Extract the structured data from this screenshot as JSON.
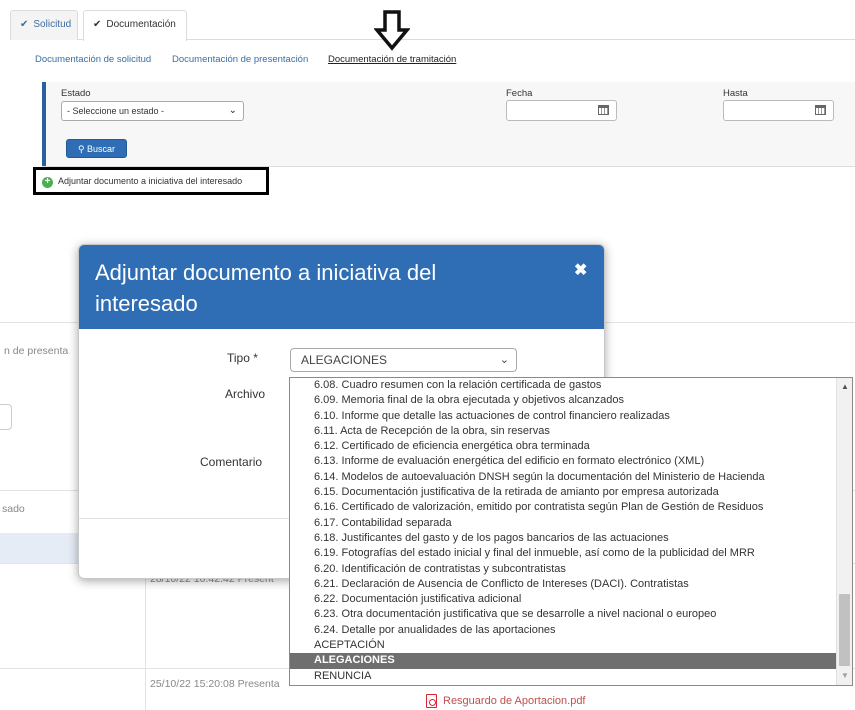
{
  "tabs": {
    "solicitud": "Solicitud",
    "documentacion": "Documentación",
    "check": "✔"
  },
  "subtabs": {
    "solicitud": "Documentación de solicitud",
    "presentacion": "Documentación de presentación",
    "tramitacion": "Documentación de tramitación"
  },
  "filter": {
    "estado_label": "Estado",
    "estado_value": "- Seleccione un estado -",
    "fecha_label": "Fecha",
    "hasta_label": "Hasta",
    "buscar": "Buscar"
  },
  "attach_link": "Adjuntar documento a iniciativa del interesado",
  "background": {
    "frag_presenta": "n de presenta",
    "frag_sado": "sado",
    "row1_date": "28/10/22 10:42:42 Present",
    "row2_date": "25/10/22 15:20:08 Presenta",
    "pdf": "Resguardo de Aportacion.pdf"
  },
  "modal": {
    "title": "Adjuntar documento a iniciativa del interesado",
    "close": "✖",
    "tipo_label": "Tipo  *",
    "tipo_value": "ALEGACIONES",
    "archivo_label": "Archivo",
    "comentario_label": "Comentario"
  },
  "dropdown": {
    "items": [
      {
        "text": "6.08. Cuadro resumen con la relación certificada de gastos",
        "kind": "indent"
      },
      {
        "text": "6.09. Memoria final de la obra ejecutada y objetivos alcanzados",
        "kind": "indent"
      },
      {
        "text": "6.10. Informe que detalle las actuaciones de control financiero realizadas",
        "kind": "indent"
      },
      {
        "text": "6.11. Acta de Recepción de la obra, sin reservas",
        "kind": "indent"
      },
      {
        "text": "6.12. Certificado de eficiencia energética obra terminada",
        "kind": "indent"
      },
      {
        "text": "6.13. Informe de evaluación energética del edificio en formato electrónico (XML)",
        "kind": "indent"
      },
      {
        "text": "6.14. Modelos de autoevaluación DNSH según la documentación del Ministerio de Hacienda",
        "kind": "indent"
      },
      {
        "text": "6.15. Documentación justificativa de la retirada de amianto por empresa autorizada",
        "kind": "indent"
      },
      {
        "text": "6.16. Certificado de valorización, emitido por contratista según Plan de Gestión de Residuos",
        "kind": "indent"
      },
      {
        "text": "6.17. Contabilidad separada",
        "kind": "indent"
      },
      {
        "text": "6.18. Justificantes del gasto y de los pagos bancarios de las actuaciones",
        "kind": "indent"
      },
      {
        "text": "6.19. Fotografías del estado inicial y final del inmueble, así como de la publicidad del MRR",
        "kind": "indent"
      },
      {
        "text": "6.20. Identificación de contratistas y subcontratistas",
        "kind": "indent"
      },
      {
        "text": "6.21. Declaración de Ausencia de Conflicto de Intereses (DACI). Contratistas",
        "kind": "indent"
      },
      {
        "text": "6.22. Documentación justificativa adicional",
        "kind": "indent"
      },
      {
        "text": "6.23. Otra documentación justificativa que se desarrolle a nivel nacional o europeo",
        "kind": "indent"
      },
      {
        "text": "6.24. Detalle por anualidades de las aportaciones",
        "kind": "indent"
      },
      {
        "text": "ACEPTACIÓN",
        "kind": "group"
      },
      {
        "text": "ALEGACIONES",
        "kind": "group sel"
      },
      {
        "text": "RENUNCIA",
        "kind": "group"
      }
    ],
    "scroll_up": "▲",
    "scroll_down": "▼"
  }
}
